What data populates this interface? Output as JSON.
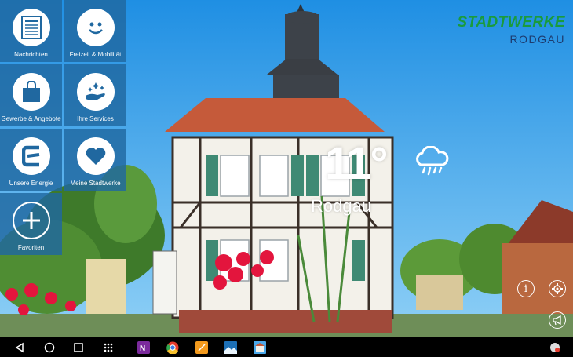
{
  "app": {
    "logo_brand": "STADTWERKE",
    "logo_city": "RODGAU"
  },
  "tiles": [
    {
      "label": "Nachrichten",
      "icon": "newspaper-icon"
    },
    {
      "label": "Freizeit & Mobilität",
      "icon": "smiley-icon"
    },
    {
      "label": "Gewerbe & Angebote",
      "icon": "shopping-bag-icon"
    },
    {
      "label": "Ihre Services",
      "icon": "hand-sparkle-icon"
    },
    {
      "label": "Unsere Energie",
      "icon": "energy-e-icon"
    },
    {
      "label": "Meine Stadtwerke",
      "icon": "heart-icon"
    },
    {
      "label": "Favoriten",
      "icon": "plus-icon"
    }
  ],
  "weather": {
    "temperature": "11°",
    "location": "Rodgau",
    "condition_icon": "cloud-rain-icon"
  },
  "side_icons": [
    "info-icon",
    "settings-icon",
    "megaphone-icon"
  ],
  "taskbar": {
    "nav": [
      "back-icon",
      "home-icon",
      "recents-icon",
      "apps-grid-icon"
    ],
    "apps": [
      "onenote-icon",
      "chrome-icon",
      "notes-icon",
      "photo-app-icon",
      "stadtwerke-app-icon"
    ],
    "tray": [
      "notification-icon"
    ]
  },
  "colors": {
    "tile_bg": "#2068a0",
    "sky": "#4aa8ea",
    "brand_green": "#1a9b3c",
    "brand_blue": "#1d3b6e"
  }
}
